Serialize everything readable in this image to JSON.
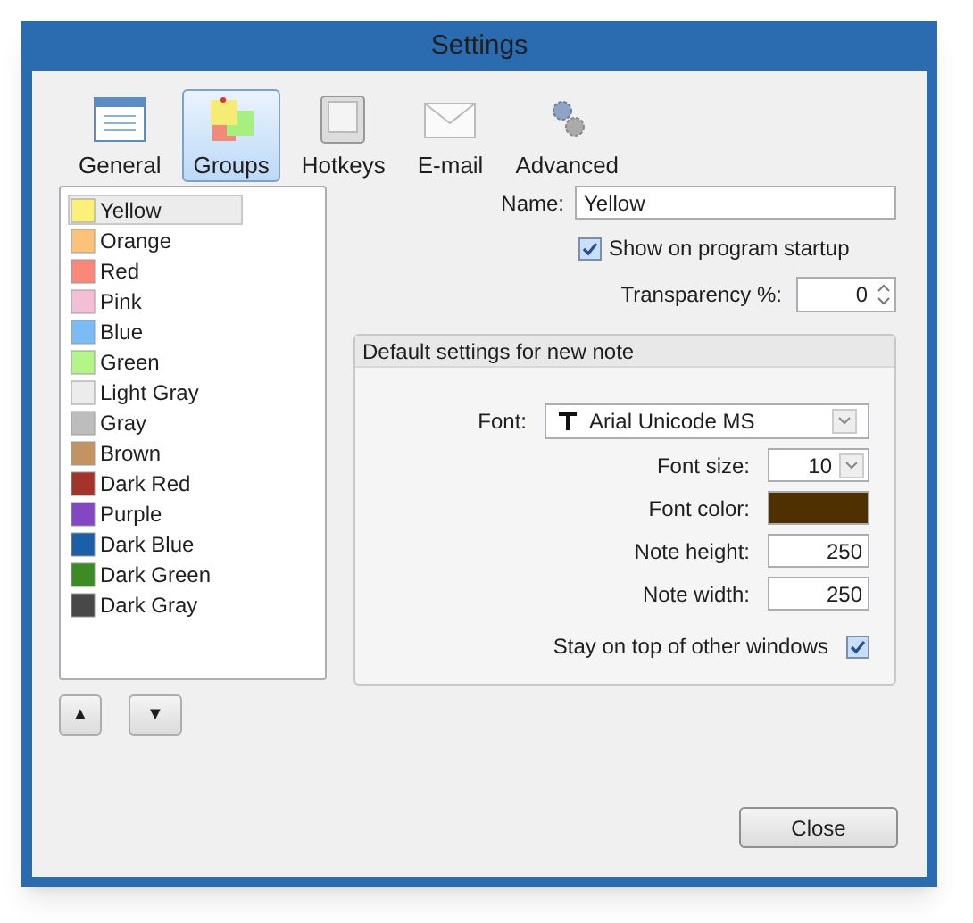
{
  "window": {
    "title": "Settings"
  },
  "tabs": [
    {
      "label": "General",
      "kind": "window",
      "selected": false
    },
    {
      "label": "Groups",
      "kind": "notes",
      "selected": true
    },
    {
      "label": "Hotkeys",
      "kind": "key",
      "selected": false
    },
    {
      "label": "E-mail",
      "kind": "mail",
      "selected": false
    },
    {
      "label": "Advanced",
      "kind": "gears",
      "selected": false
    }
  ],
  "groups": [
    {
      "label": "Yellow",
      "color": "#fbf17a",
      "selected": true
    },
    {
      "label": "Orange",
      "color": "#fcc27a",
      "selected": false
    },
    {
      "label": "Red",
      "color": "#f9877a",
      "selected": false
    },
    {
      "label": "Pink",
      "color": "#f4bfd6",
      "selected": false
    },
    {
      "label": "Blue",
      "color": "#7cbcf5",
      "selected": false
    },
    {
      "label": "Green",
      "color": "#b4f589",
      "selected": false
    },
    {
      "label": "Light Gray",
      "color": "#ececec",
      "selected": false
    },
    {
      "label": "Gray",
      "color": "#bdbdbd",
      "selected": false
    },
    {
      "label": "Brown",
      "color": "#c19462",
      "selected": false
    },
    {
      "label": "Dark Red",
      "color": "#a3342a",
      "selected": false
    },
    {
      "label": "Purple",
      "color": "#8347c4",
      "selected": false
    },
    {
      "label": "Dark Blue",
      "color": "#1c5fa6",
      "selected": false
    },
    {
      "label": "Dark Green",
      "color": "#3b8c24",
      "selected": false
    },
    {
      "label": "Dark Gray",
      "color": "#484848",
      "selected": false
    }
  ],
  "move_buttons": [
    "▲",
    "▼"
  ],
  "name": {
    "label": "Name:",
    "value": "Yellow"
  },
  "show_on_startup": {
    "label": "Show on program startup",
    "checked": true
  },
  "transparency": {
    "label": "Transparency %:",
    "value": "0"
  },
  "defaults": {
    "title": "Default settings for new note",
    "font": {
      "label": "Font:",
      "value": "Arial Unicode MS"
    },
    "font_size": {
      "label": "Font size:",
      "value": "10"
    },
    "font_color": {
      "label": "Font color:",
      "color": "#4f3000"
    },
    "note_height": {
      "label": "Note height:",
      "value": "250"
    },
    "note_width": {
      "label": "Note width:",
      "value": "250"
    },
    "stay_on_top": {
      "label": "Stay on top of other windows",
      "checked": true
    }
  },
  "close_button": "Close"
}
